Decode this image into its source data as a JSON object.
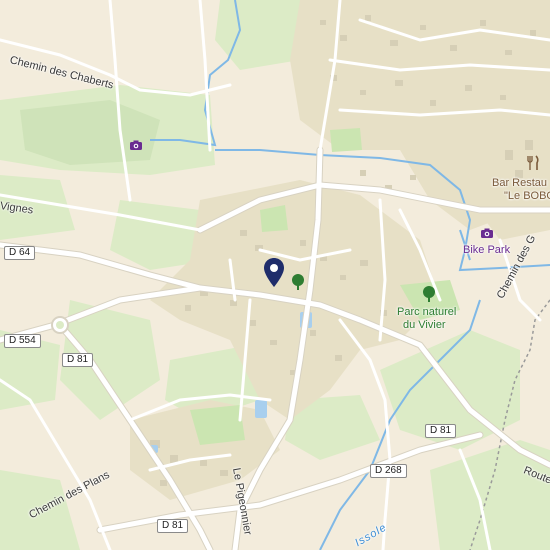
{
  "map": {
    "colors": {
      "land": "#f3ecdc",
      "urban": "#e7e0c6",
      "building": "#d6cfb6",
      "green": "#dcebc6",
      "park": "#cbe5b1",
      "water": "#7fb8e6",
      "road": "#ffffff",
      "pin": "#1f2d6b"
    },
    "labels": {
      "chaberts": "Chemin des Chaberts",
      "vignes": "Vignes",
      "chemin_des_g": "Chemin des G",
      "plans": "Chemin des Plans",
      "pigeonnier": "Le Pigeonnier",
      "route": "Route",
      "bar_line1": "Bar Restau",
      "bar_line2": "\"Le BOBO",
      "bike_park": "Bike Park",
      "parc_line1": "Parc naturel",
      "parc_line2": "du Vivier",
      "river": "Issole"
    },
    "shields": {
      "d64": "D 64",
      "d554": "D 554",
      "d81_west": "D 81",
      "d81_east": "D 81",
      "d81_south": "D 81",
      "d268": "D 268"
    },
    "icons": {
      "pin": "map-pin-icon",
      "tree_center": "tree-icon",
      "tree_park": "tree-icon",
      "camera_west": "camera-icon",
      "camera_bike": "camera-icon",
      "restaurant": "fork-knife-icon"
    }
  }
}
